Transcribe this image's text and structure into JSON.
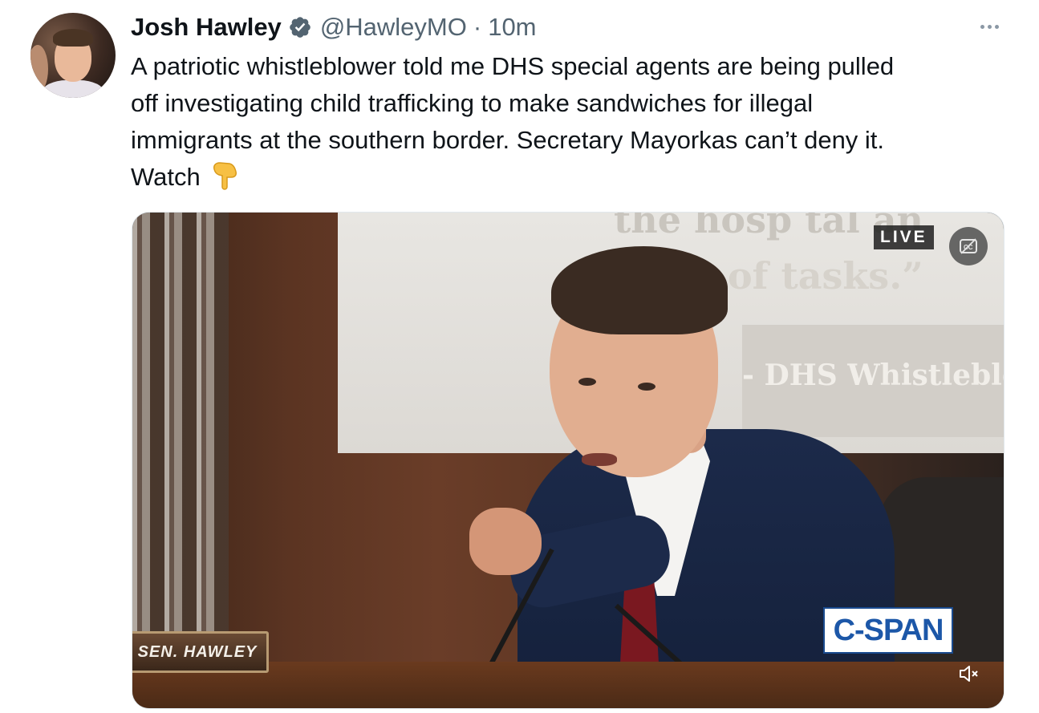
{
  "author": {
    "name": "Josh Hawley",
    "handle": "@HawleyMO",
    "separator": "·",
    "time": "10m",
    "verified_icon": "verified-badge-icon"
  },
  "tweet": {
    "text": "A patriotic whistleblower told me DHS special agents are being pulled\noff investigating child trafficking to make sandwiches for illegal\nimmigrants at the southern border. Secretary Mayorkas can’t deny it.\nWatch",
    "emoji_icon": "pointing-down-icon"
  },
  "video": {
    "live_label": "LIVE",
    "channel_logo": "C-SPAN",
    "nameplate": "SEN. HAWLEY",
    "board_top": "the hosp tal an",
    "board_quote": "of tasks.”",
    "board_attribution": "- DHS Whistleblow",
    "controls": {
      "captions_icon": "closed-captions-icon",
      "mute_icon": "volume-muted-icon"
    }
  },
  "colors": {
    "text_primary": "#0f1419",
    "text_secondary": "#536471",
    "verified_blue": "#536471",
    "cspan_blue": "#1c57a8"
  }
}
